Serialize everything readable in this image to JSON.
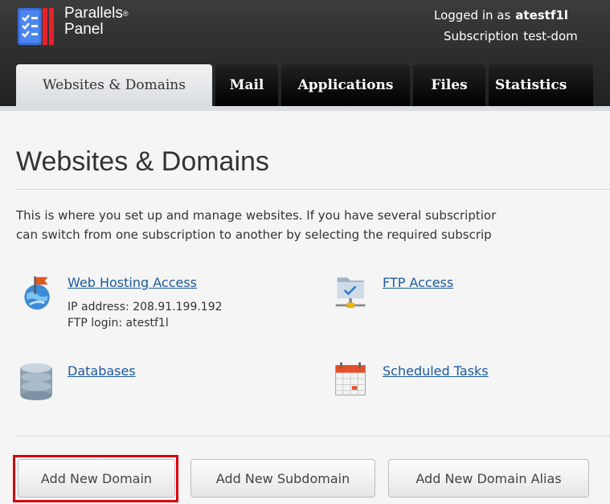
{
  "header": {
    "brand": "Parallels",
    "brand_mark": "®",
    "product": "Panel",
    "logged_in_label": "Logged in as",
    "username": "atestf1l",
    "subscription_label": "Subscription",
    "subscription_value": "test-dom"
  },
  "tabs": [
    {
      "label": "Websites & Domains"
    },
    {
      "label": "Mail"
    },
    {
      "label": "Applications"
    },
    {
      "label": "Files"
    },
    {
      "label": "Statistics"
    }
  ],
  "main": {
    "title": "Websites & Domains",
    "description_line1": "This is where you set up and manage websites. If you have several subscriptior",
    "description_line2": "can switch from one subscription to another by selecting the required subscrip",
    "items": {
      "web_hosting": {
        "label": "Web Hosting Access",
        "ip_line": "IP address: 208.91.199.192",
        "ftp_line": "FTP login: atestf1l"
      },
      "ftp": {
        "label": "FTP Access"
      },
      "databases": {
        "label": "Databases"
      },
      "scheduled": {
        "label": "Scheduled Tasks"
      }
    },
    "buttons": {
      "add_domain": "Add New Domain",
      "add_subdomain": "Add New Subdomain",
      "add_alias": "Add New Domain Alias"
    }
  },
  "colors": {
    "link": "#1a5aa5",
    "highlight": "#d9000d",
    "header_bg": "#2b2b2b"
  },
  "icons": {
    "logo": "parallels-logo-icon",
    "web_hosting": "globe-flag-icon",
    "ftp": "folder-network-icon",
    "databases": "database-icon",
    "scheduled": "calendar-icon"
  }
}
